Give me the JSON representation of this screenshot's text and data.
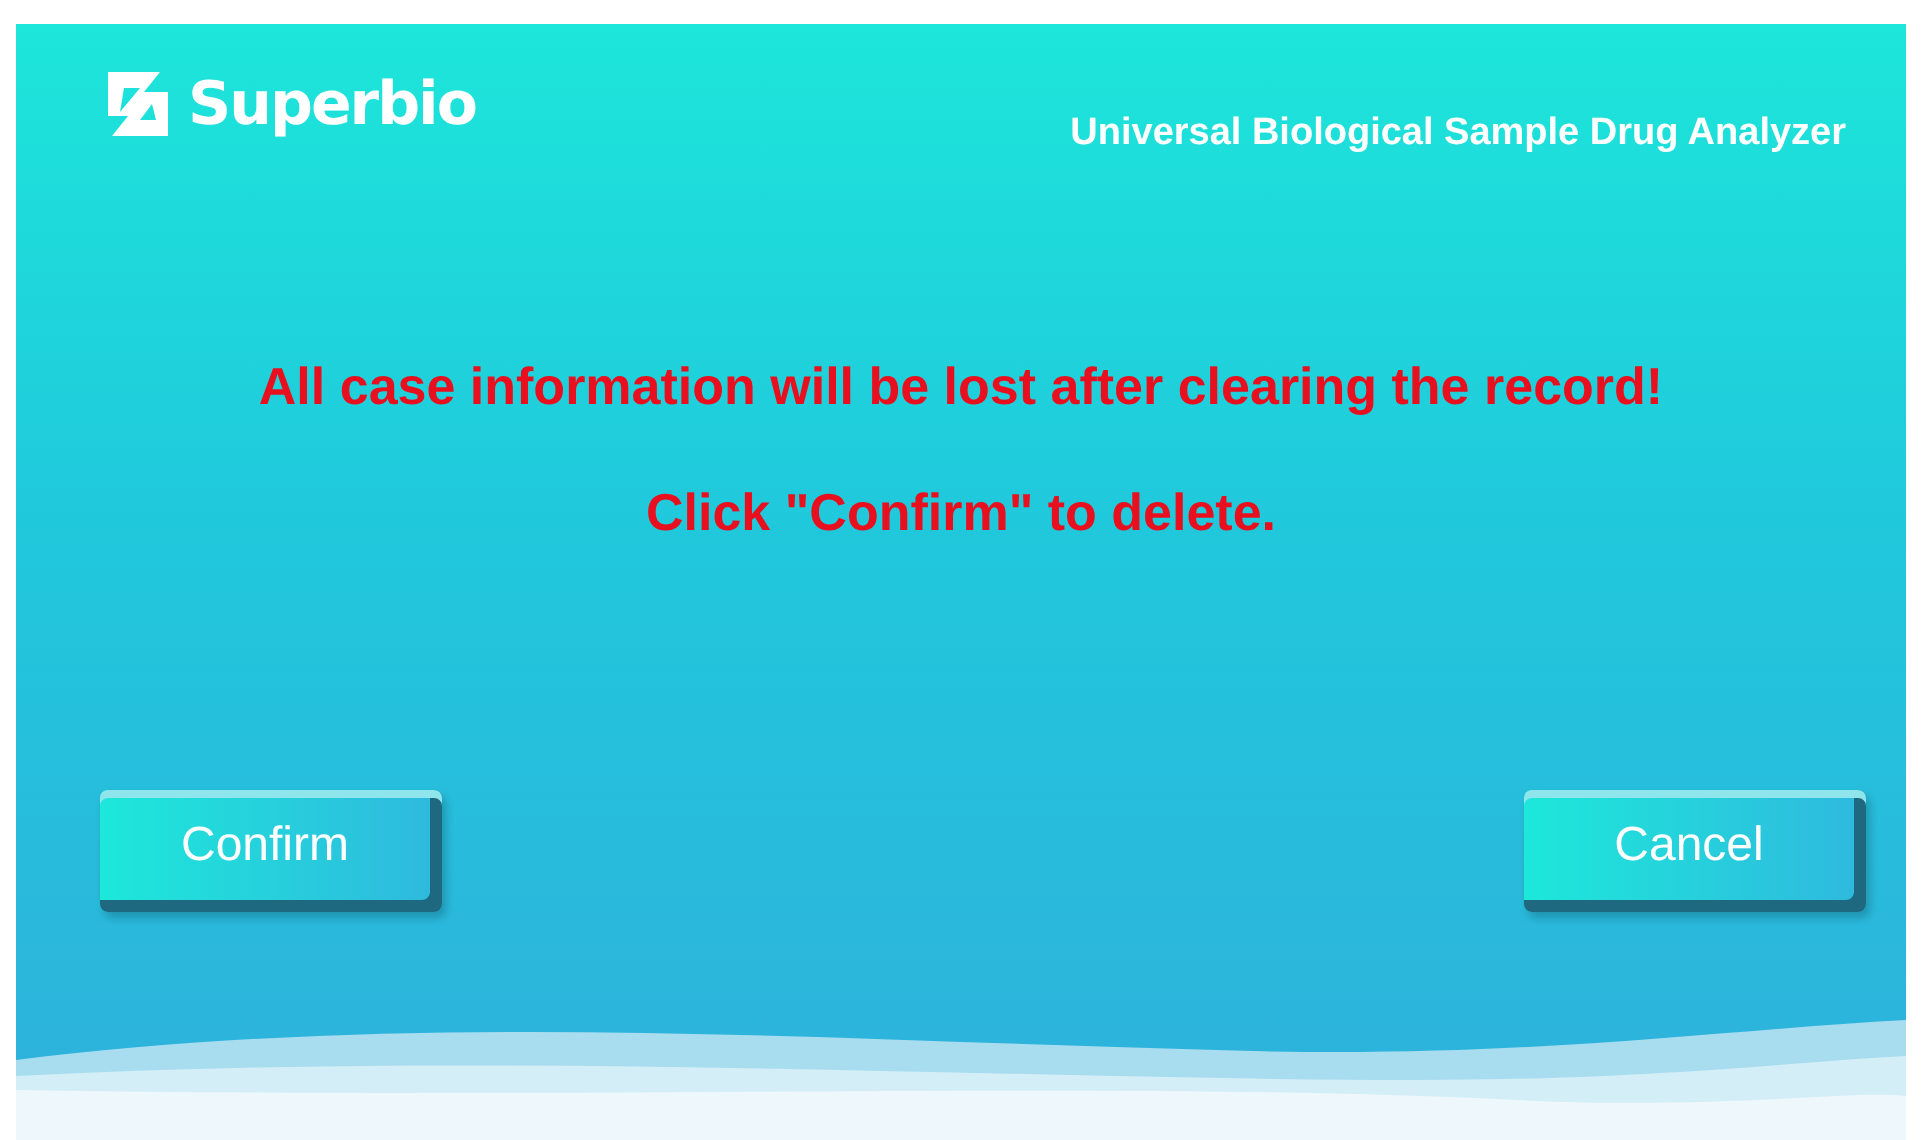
{
  "header": {
    "logo": "Superbio",
    "title": "Universal Biological Sample Drug Analyzer"
  },
  "messages": [
    "All case information will be lost after clearing the record!",
    "Click \"Confirm\" to delete."
  ],
  "buttons": [
    {
      "label": "Confirm"
    },
    {
      "label": "Cancel"
    }
  ]
}
